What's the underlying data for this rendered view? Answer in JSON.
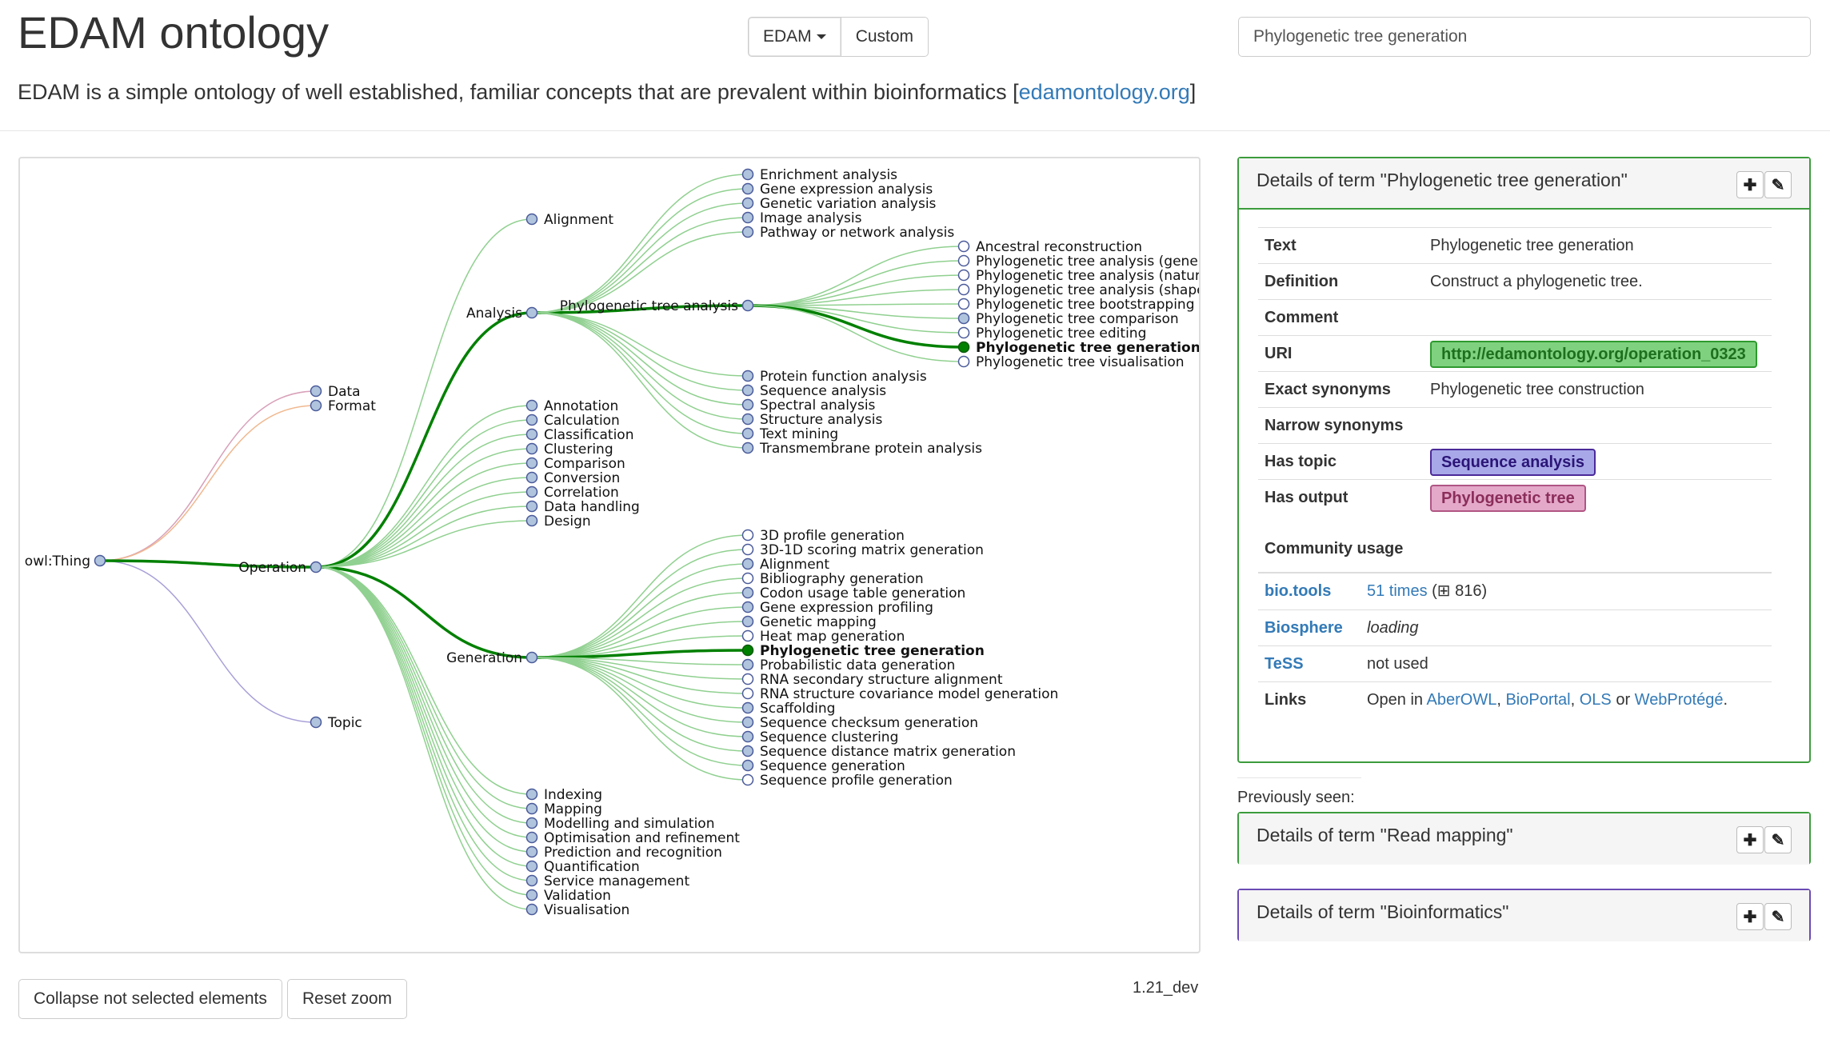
{
  "header": {
    "title": "EDAM ontology",
    "lead_text": "EDAM is a simple ontology of well established, familiar concepts that are prevalent within bioinformatics [",
    "lead_link": "edamontology.org",
    "lead_end": "]",
    "dropdown_label": "EDAM",
    "custom_label": "Custom",
    "search_value": "Phylogenetic tree generation"
  },
  "tree": {
    "root": "owl:Thing",
    "level1": [
      "Data",
      "Format",
      "Operation",
      "Topic"
    ],
    "analysis": "Analysis",
    "generation": "Generation",
    "alignment": "Alignment",
    "phylo_analysis": "Phylogenetic tree analysis",
    "analysis_children_top": [
      "Enrichment analysis",
      "Gene expression analysis",
      "Genetic variation analysis",
      "Image analysis",
      "Pathway or network analysis"
    ],
    "analysis_children_bottom": [
      "Protein function analysis",
      "Sequence analysis",
      "Spectral analysis",
      "Structure analysis",
      "Text mining",
      "Transmembrane protein analysis"
    ],
    "phylo_children": [
      "Ancestral reconstruction",
      "Phylogenetic tree analysis (gene fam",
      "Phylogenetic tree analysis (natural s",
      "Phylogenetic tree analysis (shape)",
      "Phylogenetic tree bootstrapping",
      "Phylogenetic tree comparison",
      "Phylogenetic tree editing",
      "Phylogenetic tree generation",
      "Phylogenetic tree visualisation"
    ],
    "operation_mid_children": [
      "Annotation",
      "Calculation",
      "Classification",
      "Clustering",
      "Comparison",
      "Conversion",
      "Correlation",
      "Data handling",
      "Design"
    ],
    "generation_children": [
      "3D profile generation",
      "3D-1D scoring matrix generation",
      "Alignment",
      "Bibliography generation",
      "Codon usage table generation",
      "Gene expression profiling",
      "Genetic mapping",
      "Heat map generation",
      "Phylogenetic tree generation",
      "Probabilistic data generation",
      "RNA secondary structure alignment",
      "RNA structure covariance model generation",
      "Scaffolding",
      "Sequence checksum generation",
      "Sequence clustering",
      "Sequence distance matrix generation",
      "Sequence generation",
      "Sequence profile generation"
    ],
    "operation_bottom_children": [
      "Indexing",
      "Mapping",
      "Modelling and simulation",
      "Optimisation and refinement",
      "Prediction and recognition",
      "Quantification",
      "Service management",
      "Validation",
      "Visualisation"
    ],
    "colors": {
      "selected": "#008000",
      "operation_edge": "#90d090",
      "data_edge": "#d8a0b8",
      "format_edge": "#f0b890",
      "topic_edge": "#a8a0d8",
      "node_fill": "#b0c4de",
      "node_stroke": "#4a5a9a"
    }
  },
  "controls": {
    "collapse_label": "Collapse not selected elements",
    "reset_label": "Reset zoom",
    "version": "1.21_dev"
  },
  "details": {
    "heading": "Details of term \"Phylogenetic tree generation\"",
    "rows": [
      {
        "k": "Text",
        "v": "Phylogenetic tree generation"
      },
      {
        "k": "Definition",
        "v": "Construct a phylogenetic tree."
      },
      {
        "k": "Comment",
        "v": ""
      },
      {
        "k": "URI",
        "v": "http://edamontology.org/operation_0323"
      },
      {
        "k": "Exact synonyms",
        "v": "Phylogenetic tree construction"
      },
      {
        "k": "Narrow synonyms",
        "v": ""
      },
      {
        "k": "Has topic",
        "v": "Sequence analysis"
      },
      {
        "k": "Has output",
        "v": "Phylogenetic tree"
      }
    ],
    "community_title": "Community usage",
    "community": [
      {
        "k": "bio.tools",
        "v_link": "51 times",
        "v_extra": " (⊞ 816)"
      },
      {
        "k": "Biosphere",
        "v": "loading"
      },
      {
        "k": "TeSS",
        "v_link": "not used"
      }
    ],
    "links_label": "Links",
    "links_prefix": "Open in ",
    "links": [
      "AberOWL",
      "BioPortal",
      "OLS",
      "WebProtégé"
    ],
    "links_sep1": ", ",
    "links_or": " or ",
    "links_end": "."
  },
  "previously_seen": {
    "label": "Previously seen:",
    "items": [
      "Details of term \"Read mapping\"",
      "Details of term \"Bioinformatics\""
    ]
  },
  "icons": {
    "add": "plus-icon",
    "edit": "pencil-icon"
  }
}
